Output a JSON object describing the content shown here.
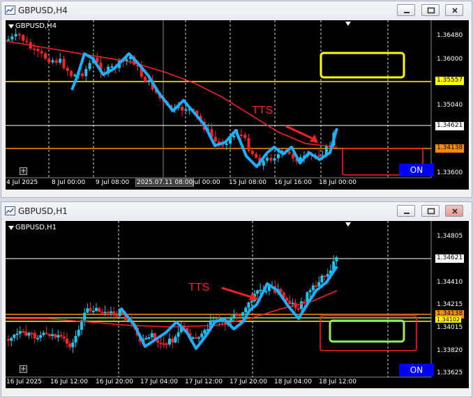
{
  "windows": [
    {
      "title": "GBPUSD,H4",
      "symbol_label": "GBPUSD,H4",
      "price_scale": [
        "1.36480",
        "1.36000",
        "1.35557",
        "1.35040",
        "1.34621",
        "1.34138",
        "1.33600"
      ],
      "time_axis": [
        "4 Jul 2025",
        "8 Jul 00:00",
        "9 Jul 08:00",
        "2025.07.11 08:00",
        "Jul 00:00",
        "15 Jul 08:00",
        "16 Jul 16:00",
        "18 Jul 00:00"
      ],
      "annotation": "TTS",
      "on_button": "ON",
      "colors": {
        "yellow_level": "#ffff00",
        "orange_level": "#ff8c00",
        "bull": "#19c6f0",
        "bear": "#ff2020",
        "ma": "#ff2020",
        "trace": "#1ab0ff"
      }
    },
    {
      "title": "GBPUSD,H1",
      "symbol_label": "GBPUSD,H1",
      "price_scale": [
        "1.34805",
        "1.34621",
        "1.34410",
        "1.34215",
        "1.34138",
        "1.34102",
        "1.34015",
        "1.33820",
        "1.33625"
      ],
      "time_axis": [
        "16 Jul 2025",
        "16 Jul 12:00",
        "16 Jul 20:00",
        "17 Jul 04:00",
        "17 Jul 12:00",
        "17 Jul 20:00",
        "18 Jul 04:00",
        "18 Jul 12:00"
      ],
      "annotation": "TTS",
      "on_button": "ON",
      "colors": {
        "yellow_level": "#ffff00",
        "orange_level": "#ff8c00",
        "green_level": "#90ee60"
      }
    }
  ]
}
